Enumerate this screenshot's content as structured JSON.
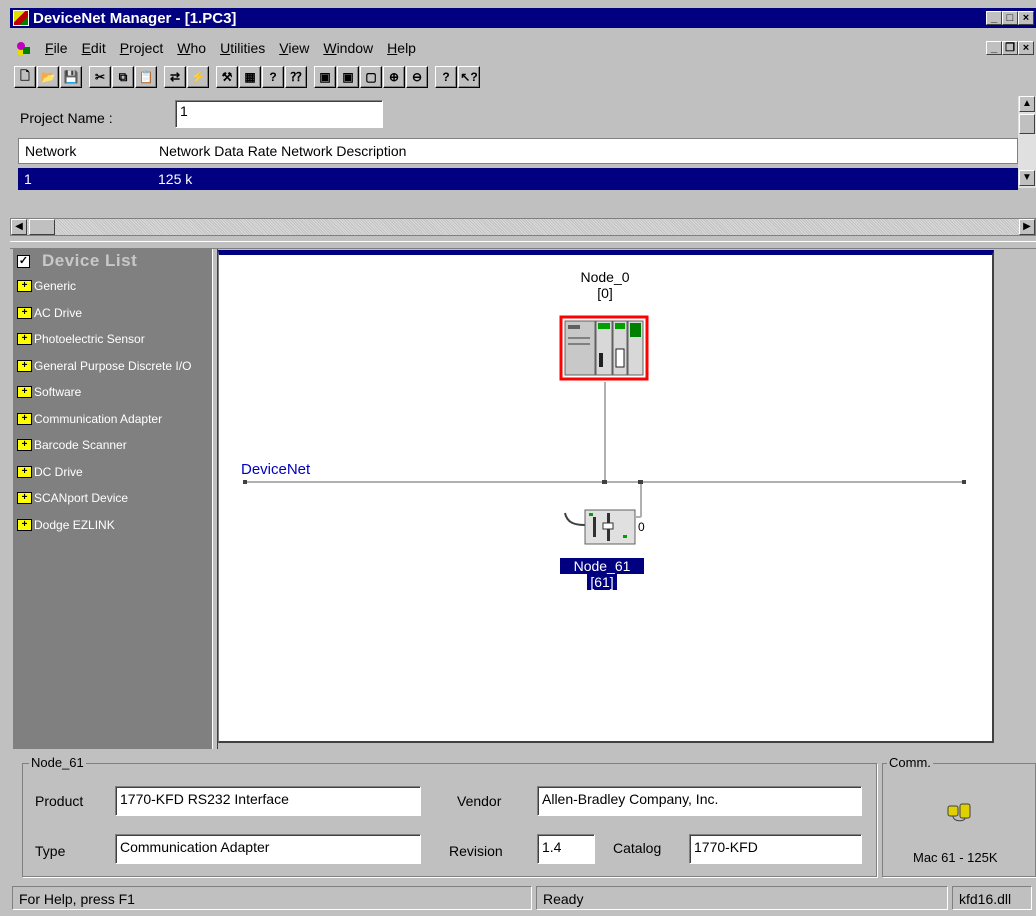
{
  "window": {
    "title": "DeviceNet Manager - [1.PC3]",
    "min_glyph": "_",
    "max_glyph": "□",
    "close_glyph": "×",
    "restore_glyph": "❐"
  },
  "menu": [
    "File",
    "Edit",
    "Project",
    "Who",
    "Utilities",
    "View",
    "Window",
    "Help"
  ],
  "toolbar": {
    "buttons": [
      {
        "icon": "new-doc-icon",
        "glyph": "🗋"
      },
      {
        "icon": "open-folder-icon",
        "glyph": "📂"
      },
      {
        "icon": "save-icon",
        "glyph": "💾"
      },
      {
        "sep": true
      },
      {
        "icon": "cut-icon",
        "glyph": "✂"
      },
      {
        "icon": "copy-icon",
        "glyph": "⧉"
      },
      {
        "icon": "paste-icon",
        "glyph": "📋"
      },
      {
        "sep": true
      },
      {
        "icon": "network-who-icon",
        "glyph": "⇄"
      },
      {
        "icon": "connect-icon",
        "glyph": "⚡"
      },
      {
        "sep": true
      },
      {
        "icon": "tools-icon",
        "glyph": "⚒"
      },
      {
        "icon": "grid-icon",
        "glyph": "▦"
      },
      {
        "icon": "query-icon",
        "glyph": "?"
      },
      {
        "icon": "query-grid-icon",
        "glyph": "⁇"
      },
      {
        "sep": true
      },
      {
        "icon": "window-1-icon",
        "glyph": "▣"
      },
      {
        "icon": "window-2-icon",
        "glyph": "▣"
      },
      {
        "icon": "window-3-icon",
        "glyph": "▢"
      },
      {
        "icon": "zoom-in-icon",
        "glyph": "⊕"
      },
      {
        "icon": "zoom-out-icon",
        "glyph": "⊖"
      },
      {
        "sep": true
      },
      {
        "icon": "help-icon",
        "glyph": "?"
      },
      {
        "icon": "context-help-icon",
        "glyph": "↖?"
      }
    ]
  },
  "project": {
    "name_label": "Project Name :",
    "name_value": "1",
    "header": {
      "network": "Network",
      "rest": "Network Data Rate  Network Description"
    },
    "row": {
      "network": "1",
      "rate": "125 k"
    }
  },
  "device_list": {
    "checked": "✓",
    "title": "Device List",
    "expand_glyph": "+",
    "items": [
      "Generic",
      "AC Drive",
      "Photoelectric Sensor",
      "General Purpose Discrete I/O",
      "Software",
      "Communication Adapter",
      "Barcode Scanner",
      "DC Drive",
      "SCANport Device",
      "Dodge EZLINK"
    ]
  },
  "canvas": {
    "network_label": "DeviceNet",
    "node0": {
      "name": "Node_0",
      "addr": "[0]"
    },
    "node61": {
      "name": "Node_61",
      "addr": "[61]"
    }
  },
  "info": {
    "group_title": "Node_61",
    "product_label": "Product",
    "product_value": "1770-KFD RS232 Interface",
    "vendor_label": "Vendor",
    "vendor_value": "Allen-Bradley Company, Inc.",
    "type_label": "Type",
    "type_value": "Communication Adapter",
    "revision_label": "Revision",
    "revision_value": "1.4",
    "catalog_label": "Catalog",
    "catalog_value": "1770-KFD",
    "comm_title": "Comm.",
    "comm_status": "Mac 61 - 125K"
  },
  "status": {
    "help": "For Help, press F1",
    "state": "Ready",
    "driver": "kfd16.dll"
  },
  "colors": {
    "titlebar": "#000080",
    "selection": "#000080",
    "panel": "#c0c0c0",
    "device_list_bg": "#808080",
    "network_label": "#0000c0",
    "node0_border": "#ff0000"
  }
}
